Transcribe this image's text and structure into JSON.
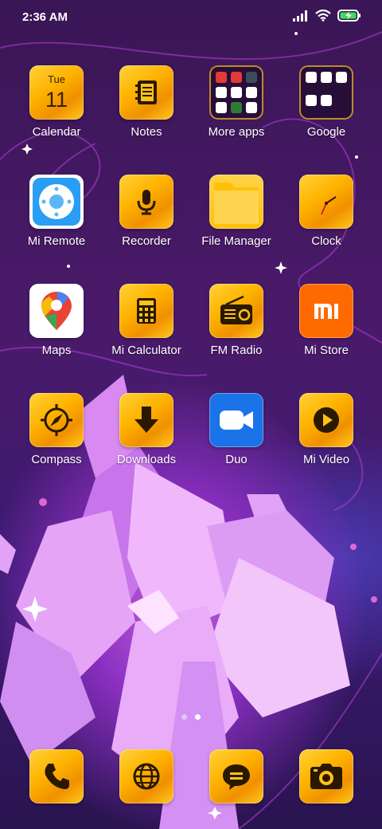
{
  "status_bar": {
    "time": "2:36 AM",
    "icons": [
      "signal-icon",
      "wifi-icon",
      "battery-charging-icon"
    ]
  },
  "apps": {
    "calendar": {
      "label": "Calendar",
      "day": "Tue",
      "date": "11",
      "icon": "calendar-icon"
    },
    "notes": {
      "label": "Notes",
      "icon": "notepad-icon"
    },
    "more_apps": {
      "label": "More apps",
      "icon": "folder-icon"
    },
    "google": {
      "label": "Google",
      "icon": "folder-icon"
    },
    "mi_remote": {
      "label": "Mi Remote",
      "icon": "remote-icon"
    },
    "recorder": {
      "label": "Recorder",
      "icon": "microphone-icon"
    },
    "file_manager": {
      "label": "File Manager",
      "icon": "folder-file-icon"
    },
    "clock": {
      "label": "Clock",
      "icon": "clock-icon"
    },
    "maps": {
      "label": "Maps",
      "icon": "map-pin-icon"
    },
    "mi_calculator": {
      "label": "Mi Calculator",
      "icon": "calculator-icon"
    },
    "fm_radio": {
      "label": "FM Radio",
      "icon": "radio-icon"
    },
    "mi_store": {
      "label": "Mi Store",
      "icon": "mi-logo-icon"
    },
    "compass": {
      "label": "Compass",
      "icon": "compass-icon"
    },
    "downloads": {
      "label": "Downloads",
      "icon": "download-arrow-icon"
    },
    "duo": {
      "label": "Duo",
      "icon": "video-camera-icon"
    },
    "mi_video": {
      "label": "Mi Video",
      "icon": "play-icon"
    }
  },
  "dock": {
    "items": [
      "phone-icon",
      "browser-globe-icon",
      "messages-icon",
      "camera-icon"
    ]
  },
  "page_indicator": {
    "count": 2,
    "active": 2
  },
  "colors": {
    "icon_gold": "#ffb300",
    "mi_orange": "#ff6a00",
    "duo_blue": "#1a73e8",
    "remote_blue": "#2a9df4"
  }
}
